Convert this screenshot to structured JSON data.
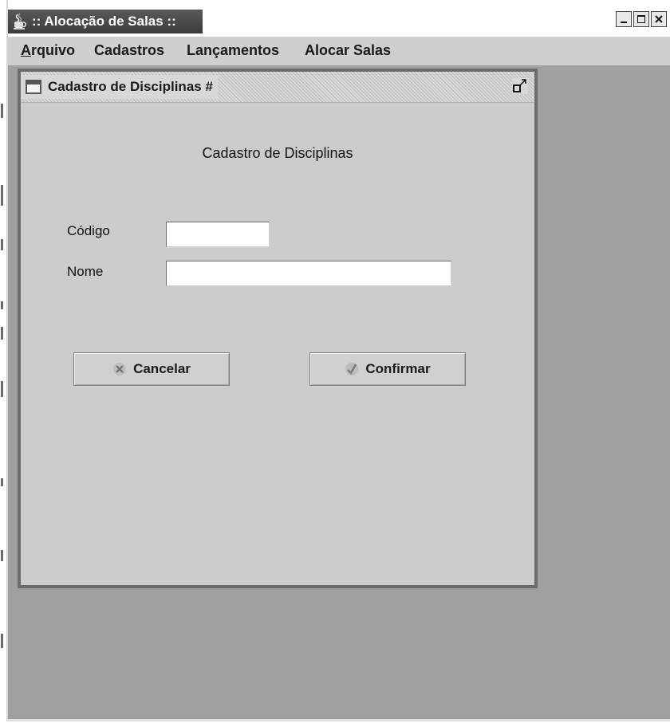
{
  "window": {
    "title": ":: Alocação de Salas ::",
    "controls": [
      "minimize",
      "maximize",
      "close"
    ]
  },
  "menubar": {
    "items": [
      {
        "label": "Arquivo",
        "mnemonic": "A"
      },
      {
        "label": "Cadastros"
      },
      {
        "label": "Lançamentos"
      },
      {
        "label": "Alocar Salas"
      }
    ]
  },
  "internal_frame": {
    "title": "Cadastro de Disciplinas #",
    "heading": "Cadastro de Disciplinas",
    "fields": {
      "codigo": {
        "label": "Código",
        "value": ""
      },
      "nome": {
        "label": "Nome",
        "value": ""
      }
    },
    "buttons": {
      "cancel": {
        "label": "Cancelar",
        "icon": "x-circle-icon"
      },
      "confirm": {
        "label": "Confirmar",
        "icon": "checkmark-icon"
      }
    }
  },
  "colors": {
    "desktop": "#a0a0a0",
    "frame_body": "#cccccc",
    "title_bar": "#3c3c3c"
  }
}
